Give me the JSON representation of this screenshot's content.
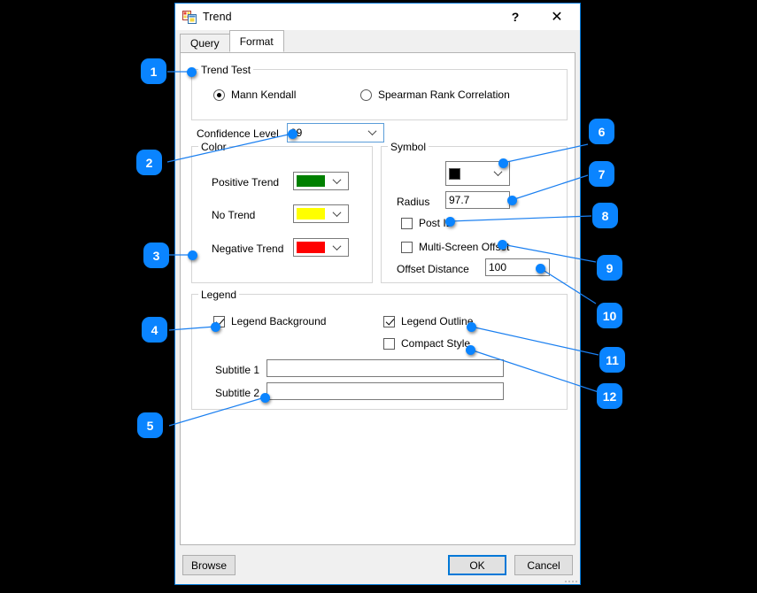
{
  "window": {
    "title": "Trend",
    "icon": "windows-form-icon",
    "help_label": "?",
    "close_label": "✕"
  },
  "tabs": [
    {
      "label": "Query",
      "active": false
    },
    {
      "label": "Format",
      "active": true
    }
  ],
  "trend_test": {
    "group_label": "Trend Test",
    "options": [
      {
        "label": "Mann Kendall",
        "checked": true
      },
      {
        "label": "Spearman Rank Correlation",
        "checked": false
      }
    ]
  },
  "confidence": {
    "label": "Confidence Level",
    "value": "99"
  },
  "color": {
    "group_label": "Color",
    "rows": [
      {
        "label": "Positive Trend",
        "color": "#008000"
      },
      {
        "label": "No Trend",
        "color": "#FFFF00"
      },
      {
        "label": "Negative Trend",
        "color": "#FF0000"
      }
    ]
  },
  "symbol": {
    "group_label": "Symbol",
    "shape": "filled-square",
    "radius_label": "Radius",
    "radius_value": "97.7",
    "post_id_label": "Post ID",
    "post_id_checked": false,
    "multi_screen_label": "Multi-Screen Offset",
    "multi_screen_checked": false,
    "offset_label": "Offset Distance",
    "offset_value": "100"
  },
  "legend": {
    "group_label": "Legend",
    "background_label": "Legend Background",
    "background_checked": true,
    "outline_label": "Legend Outline",
    "outline_checked": true,
    "compact_label": "Compact Style",
    "compact_checked": false,
    "subtitle1_label": "Subtitle 1",
    "subtitle1_value": "",
    "subtitle2_label": "Subtitle 2",
    "subtitle2_value": ""
  },
  "buttons": {
    "browse": "Browse",
    "ok": "OK",
    "cancel": "Cancel"
  },
  "callouts": [
    {
      "n": "1"
    },
    {
      "n": "2"
    },
    {
      "n": "3"
    },
    {
      "n": "4"
    },
    {
      "n": "5"
    },
    {
      "n": "6"
    },
    {
      "n": "7"
    },
    {
      "n": "8"
    },
    {
      "n": "9"
    },
    {
      "n": "10"
    },
    {
      "n": "11"
    },
    {
      "n": "12"
    }
  ],
  "theme": {
    "accent": "#0a84ff",
    "dialog_border": "#0078d7",
    "dialog_bg": "#f0f0f0"
  }
}
